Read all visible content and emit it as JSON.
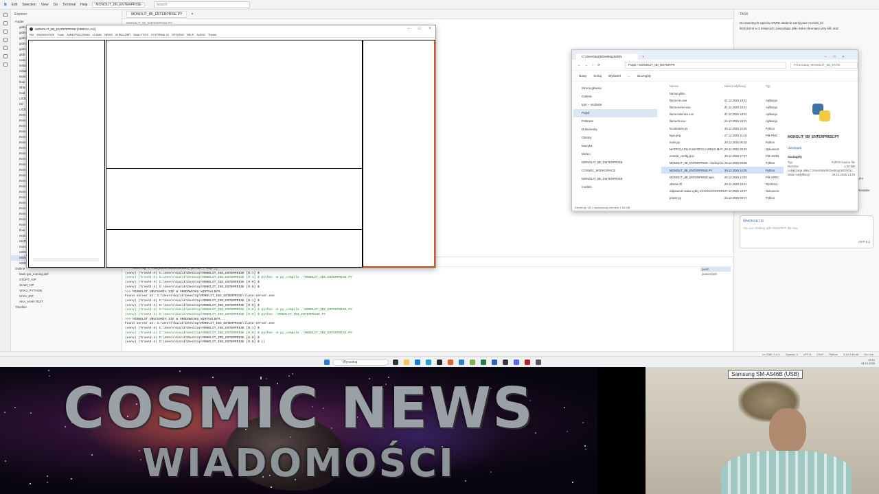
{
  "vscode": {
    "menu": [
      "Edit",
      "Selection",
      "View",
      "Go",
      "Terminal",
      "Help"
    ],
    "project": "MONOLIT_IBI_ENTERPRISE",
    "search_placeholder": "Search",
    "explorer_title": "Explorer",
    "explorer_folder": "Folder",
    "explorer_items": [
      "gidm",
      "gidm",
      "gidm",
      "gidm",
      "gidm",
      "glob",
      "exon",
      "instal",
      "initial",
      "ksmt",
      "floor",
      "ilthm",
      "lcod",
      "LICEN",
      "lctl",
      "LICEN",
      "Rem",
      "Rem",
      "Rem",
      "Rem",
      "Rem",
      "Rem",
      "Rem",
      "Rem",
      "Rem",
      "Rem",
      "Rem",
      "Rem",
      "Rem",
      "Rem",
      "Rem",
      "Rem",
      "Rem",
      "Rem",
      "Rem",
      "Rem",
      "Rem",
      "floor.py",
      "exon.py",
      "MATRYCA PLUS MATRYCA MINUS MATRYCA ROZSZCZ NOSCI.txt",
      "monolit_config.json",
      "MONOLIT_IBI_ENTERPRISE  Backup kopia.PY",
      "MONOLIT_IBI_ENTERPRISE.PY",
      "MONOLIT_IBI_ENTERPRISE.spec"
    ],
    "outline_title": "Outline",
    "outline_items": [
      "bash get_running.def",
      "STOPT_IVP",
      "SUWI_IVP",
      "VIVAJ_PYTHON",
      "VIVIV_INT",
      "AKA_VIAK-TEXT"
    ],
    "timeline_title": "Timeline",
    "editor_tab": "MONOLIT_IBI_ENTERPRISE.PY",
    "breadcrumb": "MONOLIT_IBI_ENTERPRISE.PY",
    "terminal_lines": [
      {
        "t": "    sconfig = rem(conn.Connection(\"pc:in\",\"tcp\"))",
        "c": ""
      },
      {
        "t": "(venv) (TroeAI-4) C:\\Users\\kazik\\Desktop\\MONOLIT_IBI_ENTERPRISE [0:1] $",
        "c": ""
      },
      {
        "t": "(venv) (TroeAI-4) C:\\Users\\kazik\\Desktop\\MONOLIT_IBI_ENTERPRISE [0:1] $ python -m py_compile .\\MONOLIT_IBI_ENTERPRISE.PY",
        "c": "g"
      },
      {
        "t": "(venv) (TroeAI-4) C:\\Users\\kazik\\Desktop\\MONOLIT_IBI_ENTERPRISE [0:0] $",
        "c": ""
      },
      {
        "t": "(venv) (TroeAI-4) C:\\Users\\kazik\\Desktop\\MONOLIT_IBI_ENTERPRISE [0:0] $",
        "c": ""
      },
      {
        "t": ">>> MIONOLIT URUCHAMIA SIE W SRODOWISKU WIRTUALNYM...",
        "c": ""
      },
      {
        "t": "Found server at: C:\\Users\\kazik\\Desktop\\MONOLIT_IBI_ENTERPRISE\\llana-server.exe",
        "c": ""
      },
      {
        "t": "(venv) (TroeAI-4) C:\\Users\\kazik\\Desktop\\MONOLIT_IBI_ENTERPRISE [0:1] $",
        "c": ""
      },
      {
        "t": "(venv) (TroeAI-4) C:\\Users\\kazik\\Desktop\\MONOLIT_IBI_ENTERPRISE [0:0] $",
        "c": ""
      },
      {
        "t": "(venv) (TroeAI-4) C:\\Users\\kazik\\Desktop\\MONOLIT_IBI_ENTERPRISE [0:0] $ python -m py_compile .\\MONOLIT_IBI_ENTERPRISE.PY",
        "c": "g"
      },
      {
        "t": "(venv) (TroeAI-4) C:\\Users\\kazik\\Desktop\\MONOLIT_IBI_ENTERPRISE [0:0] $ python .\\MONOLIT_IBI_ENTERPRISE.PY",
        "c": "g"
      },
      {
        "t": ">>> MIONOLIT URUCHAMIA SIE W SRODOWISKU WIRTUALNYM...",
        "c": ""
      },
      {
        "t": "Found server at: C:\\Users\\kazik\\Desktop\\MONOLIT_IBI_ENTERPRISE\\llana-server.exe",
        "c": ""
      },
      {
        "t": "(venv) (TroeAI-4) C:\\Users\\kazik\\Desktop\\MONOLIT_IBI_ENTERPRISE [0:1] $",
        "c": ""
      },
      {
        "t": "(venv) (TroeAI-4) C:\\Users\\kazik\\Desktop\\MONOLIT_IBI_ENTERPRISE [0:0] $ python -m py_compile .\\MONOLIT_IBI_ENTERPRISE.PY",
        "c": "g"
      },
      {
        "t": "(venv) (TroeAI-4) C:\\Users\\kazik\\Desktop\\MONOLIT_IBI_ENTERPRISE [0:0] $",
        "c": ""
      },
      {
        "t": "(venv) (TroeAI-4) C:\\Users\\kazik\\Desktop\\MONOLIT_IBI_ENTERPRISE [0:0] $ ||",
        "c": ""
      }
    ],
    "terminal_tabs": [
      "pwsh",
      "powershell"
    ],
    "chat_title": "TASK",
    "chat_paragraphs": [
      "Do dowolnych wpisów ARWH dodanie wersji pod: monolit_ibi",
      "Wdrożył to w 3 miejscach. powodując pliki, które chroniący przy kill; oraz",
      "Masz dwa różne \"main\" w tym projekcie:",
      "Aplikacja \"Monolit\" (GUI + AWR + cała logika runtime) to MONOLIT_IBI_ENTERPRISE.PY",
      "stary.py to osobny moduł do pozostałych sytuacji.",
      "Dodatkowo: będzie on wymagany dla MONOLIT_IBI_ENTERPRISE.PY jako wejście (Pinstaller spec)"
    ],
    "chat_code": "MONOLIT_IBI_ENTERPRISE.spec",
    "chat_completed": "Completed",
    "chat_context": "@MONOLIT.ID",
    "chat_input_placeholder": "You are chatting with MONOLIT IBI now",
    "chat_model": "GPT-5.2",
    "status_items": [
      "Ln 2280, Col 1",
      "Spaces: 4",
      "UTF-8",
      "CRLF",
      "Python",
      "3.14.2 64-bit",
      "Go Live"
    ],
    "taskbar_search": "Wyszukaj",
    "clock_time": "19:12",
    "clock_date": "04.12.2025"
  },
  "monolit_window": {
    "title": "MONOLIT_IBI_ENTERPRISE [OMEGA-AO]",
    "menu": [
      "File",
      "KNOWLEDGE",
      "Tools",
      "ZABEZPIECZENIA",
      "LLAMA",
      "NEWS",
      "AI BUILDER",
      "ANALYTICS",
      "EXTERNAL AI",
      "OPTIONS",
      "HELP",
      "AUDIO",
      "Theme"
    ],
    "controls": [
      "–",
      "□",
      "×"
    ]
  },
  "file_explorer": {
    "tab_title": "C:\\Users\\kazik\\Desktop\\MON",
    "path": "Pulpit  ›  MONOLIT_IBI_ENTERPR",
    "search_placeholder": "Przeszukaj: MONOLIT_IBI_ENTE",
    "commands": [
      "Nowy",
      "Sortuj",
      "Wyświetl",
      "...",
      "Szczegóły"
    ],
    "nav_items": [
      "Strona główna",
      "Galeria",
      "Igor – osobiste",
      "Pulpit",
      "Pobrane",
      "Dokumenty",
      "Obrazy",
      "Muzyka",
      "Wideo",
      "MONOLIT_IBI_ENTERPRISE",
      "COSMIC_WORKSPACE",
      "MONOLIT_IBI_ENTERPRISE",
      "models"
    ],
    "columns": [
      "Nazwa",
      "Data modyfikacji",
      "Typ"
    ],
    "files": [
      {
        "name": "Nazwa pliku",
        "date": "",
        "type": ""
      },
      {
        "name": "llama-run.exe",
        "date": "21.12.2025 18:21",
        "type": "Aplikacja"
      },
      {
        "name": "llama-server.exe",
        "date": "21.12.2025 18:21",
        "type": "Aplikacja"
      },
      {
        "name": "llama-tokenize.exe",
        "date": "21.12.2025 18:21",
        "type": "Aplikacja"
      },
      {
        "name": "llama-tts.exe",
        "date": "21.12.2025 18:21",
        "type": "Aplikacja"
      },
      {
        "name": "localization.py",
        "date": "28.12.2025 15:20",
        "type": "Python"
      },
      {
        "name": "logo.png",
        "date": "27.12.2025 11:19",
        "type": "Plik PNG"
      },
      {
        "name": "main.py",
        "date": "28.12.2025 06:33",
        "type": "Python"
      },
      {
        "name": "MATRYCA PLUS MATRYCA MINUS MAT...",
        "date": "28.12.2025 09:33",
        "type": "Dokument"
      },
      {
        "name": "monolit_config.json",
        "date": "28.12.2025 17:17",
        "type": "Plik JSON"
      },
      {
        "name": "MONOLIT_IBI_ENTERPRISE - backup ko...",
        "date": "28.12.2025 08:55",
        "type": "Python"
      },
      {
        "name": "MONOLIT_IBI_ENTERPRISE.PY",
        "date": "29.12.2025 14:25",
        "type": "Python"
      },
      {
        "name": "MONOLIT_IBI_ENTERPRISE.spec",
        "date": "28.12.2025 14:53",
        "type": "Plik SPEC"
      },
      {
        "name": "ollama.dll",
        "date": "28.12.2025 18:21",
        "type": "Rozszerz."
      },
      {
        "name": "odpowiedz ataka.vybrij XXXXXXXXXXXXXXX",
        "date": "27.12.2025 16:27",
        "type": "Dokument"
      },
      {
        "name": "power.py",
        "date": "22.12.2025 09:17",
        "type": "Python"
      }
    ],
    "selected_index": 11,
    "preview_name": "MONOLIT_IBI_ENTERPRISE.PY",
    "preview_link": "Udostępnij",
    "preview_section": "Szczegóły",
    "preview_details": [
      {
        "k": "Typ",
        "v": "Python source file"
      },
      {
        "k": "Rozmiar",
        "v": "1,02 MB"
      },
      {
        "k": "Lokalizacja pliku",
        "v": "C:\\Users\\kazik\\Desktop\\MONOLI..."
      },
      {
        "k": "Data modyfikacji",
        "v": "29.12.2025 14:25"
      }
    ],
    "status": "Elementy: 28     1 zaznaczony element  1,00 MB"
  },
  "stream": {
    "banner_line1": "COSMIC NEWS",
    "banner_line2": "WIADOMOŚCI",
    "webcam_label": "Samsung SM-A546B (USB)"
  },
  "colors": {
    "accent_orange": "#c65a2b",
    "selection_blue": "#cfe0f7",
    "terminal_green": "#1a8a2a"
  }
}
